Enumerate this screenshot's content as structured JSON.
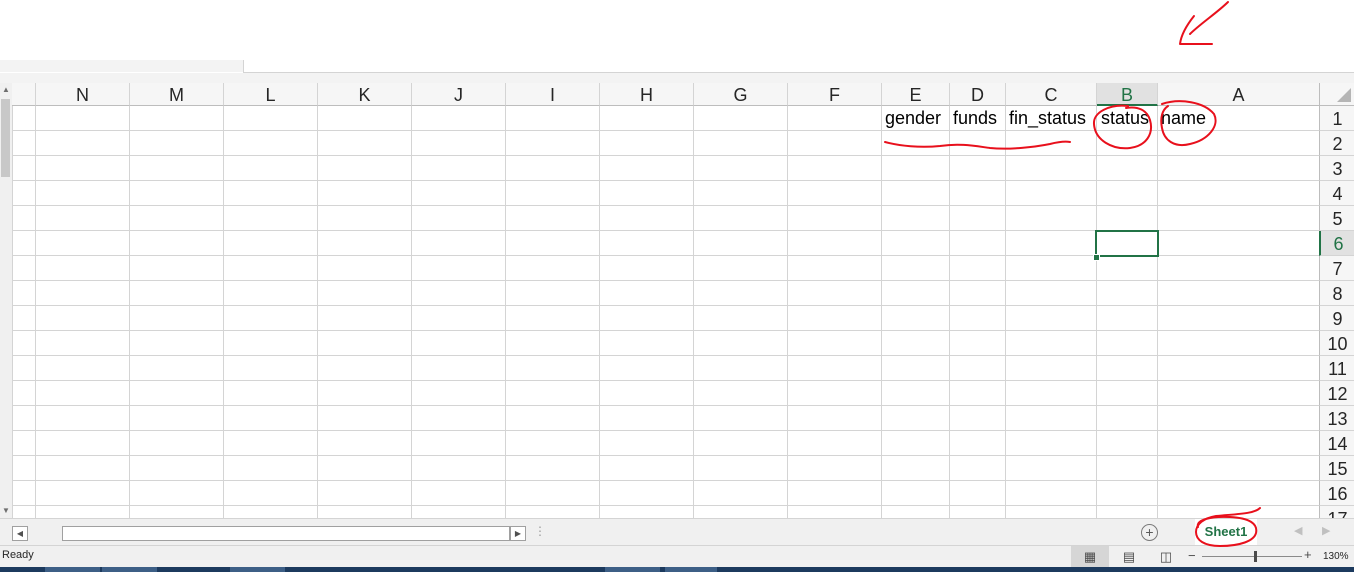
{
  "columns": [
    "N",
    "M",
    "L",
    "K",
    "J",
    "I",
    "H",
    "G",
    "F",
    "E",
    "D",
    "C",
    "B",
    "A"
  ],
  "active_column": "B",
  "rows": [
    "1",
    "2",
    "3",
    "4",
    "5",
    "6",
    "7",
    "8",
    "9",
    "10",
    "11",
    "12",
    "13",
    "14",
    "15",
    "16",
    "17"
  ],
  "active_row": "6",
  "cells": {
    "E1": "gender",
    "D1": "funds",
    "C1": "fin_status",
    "B1": "status",
    "A1": "name"
  },
  "sheet_tab": "Sheet1",
  "status": "Ready",
  "zoom_level": "130%",
  "icons": {
    "add_sheet": "plus-circle-icon",
    "normal_view": "grid-icon",
    "page_layout_view": "page-icon",
    "page_break_view": "page-break-icon"
  },
  "colors": {
    "accent": "#217346",
    "annotation": "#e8101c",
    "grid": "#d4d4d4"
  }
}
